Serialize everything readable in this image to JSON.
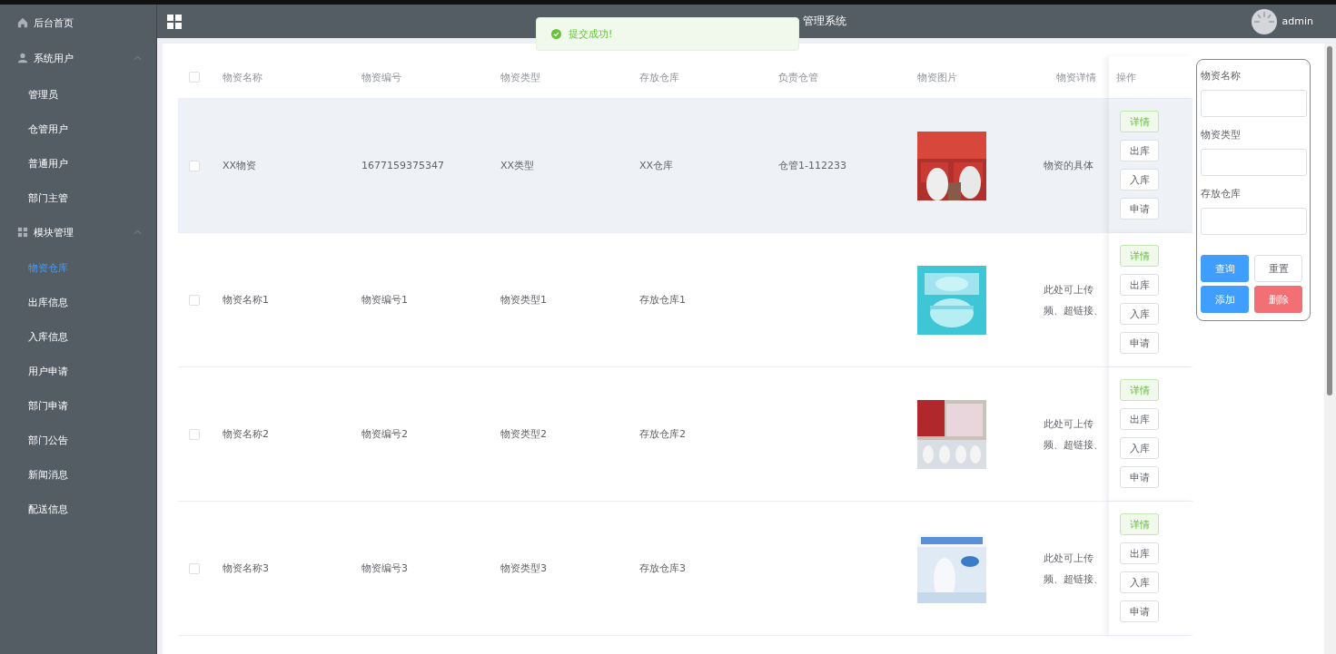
{
  "sidebar": {
    "home": {
      "label": "后台首页"
    },
    "groups": [
      {
        "label": "系统用户",
        "expanded": true,
        "children": [
          {
            "label": "管理员",
            "selected": false
          },
          {
            "label": "仓管用户",
            "selected": false
          },
          {
            "label": "普通用户",
            "selected": false
          },
          {
            "label": "部门主管",
            "selected": false
          }
        ]
      },
      {
        "label": "模块管理",
        "expanded": true,
        "children": [
          {
            "label": "物资仓库",
            "selected": true
          },
          {
            "label": "出库信息",
            "selected": false
          },
          {
            "label": "入库信息",
            "selected": false
          },
          {
            "label": "用户申请",
            "selected": false
          },
          {
            "label": "部门申请",
            "selected": false
          },
          {
            "label": "部门公告",
            "selected": false
          },
          {
            "label": "新闻消息",
            "selected": false
          },
          {
            "label": "配送信息",
            "selected": false
          }
        ]
      }
    ]
  },
  "header": {
    "title": "管理系统",
    "user": "admin"
  },
  "toast": {
    "message": "提交成功!"
  },
  "table": {
    "all_checked": false,
    "columns": [
      "物资名称",
      "物资编号",
      "物资类型",
      "存放仓库",
      "负责仓管",
      "物资图片",
      "物资详情"
    ],
    "action_column": "操作",
    "rows": [
      {
        "checked": false,
        "highlighted": true,
        "cells": [
          "XX物资",
          "1677159375347",
          "XX类型",
          "XX仓库",
          "仓管1-112233"
        ],
        "picture": {
          "kind": "picture"
        },
        "detail": [
          "物资的具体"
        ],
        "actions": [
          {
            "label": "详情",
            "kind": "success"
          },
          {
            "label": "出库",
            "kind": "default"
          },
          {
            "label": "入库",
            "kind": "default"
          },
          {
            "label": "申请",
            "kind": "default"
          }
        ]
      },
      {
        "checked": false,
        "highlighted": false,
        "cells": [
          "物资名称1",
          "物资编号1",
          "物资类型1",
          "存放仓库1"
        ],
        "picture": {
          "kind": "picture"
        },
        "detail": [
          "此处可上传",
          "频、超链接、"
        ],
        "actions": [
          {
            "label": "详情",
            "kind": "success"
          },
          {
            "label": "出库",
            "kind": "default"
          },
          {
            "label": "入库",
            "kind": "default"
          },
          {
            "label": "申请",
            "kind": "default"
          }
        ]
      },
      {
        "checked": false,
        "highlighted": false,
        "cells": [
          "物资名称2",
          "物资编号2",
          "物资类型2",
          "存放仓库2"
        ],
        "picture": {
          "kind": "picture"
        },
        "detail": [
          "此处可上传",
          "频、超链接、"
        ],
        "actions": [
          {
            "label": "详情",
            "kind": "success"
          },
          {
            "label": "出库",
            "kind": "default"
          },
          {
            "label": "入库",
            "kind": "default"
          },
          {
            "label": "申请",
            "kind": "default"
          }
        ]
      },
      {
        "checked": false,
        "highlighted": false,
        "cells": [
          "物资名称3",
          "物资编号3",
          "物资类型3",
          "存放仓库3"
        ],
        "picture": {
          "kind": "picture"
        },
        "detail": [
          "此处可上传",
          "频、超链接、"
        ],
        "actions": [
          {
            "label": "详情",
            "kind": "success"
          },
          {
            "label": "出库",
            "kind": "default"
          },
          {
            "label": "入库",
            "kind": "default"
          },
          {
            "label": "申请",
            "kind": "default"
          }
        ]
      }
    ]
  },
  "search": {
    "fields": [
      {
        "label": "物资名称"
      },
      {
        "label": "物资类型"
      },
      {
        "label": "存放仓库"
      }
    ],
    "buttons": [
      {
        "label": "查询",
        "kind": "primary"
      },
      {
        "label": "重置",
        "kind": "default"
      },
      {
        "label": "添加",
        "kind": "primary"
      },
      {
        "label": "删除",
        "kind": "danger"
      }
    ]
  }
}
